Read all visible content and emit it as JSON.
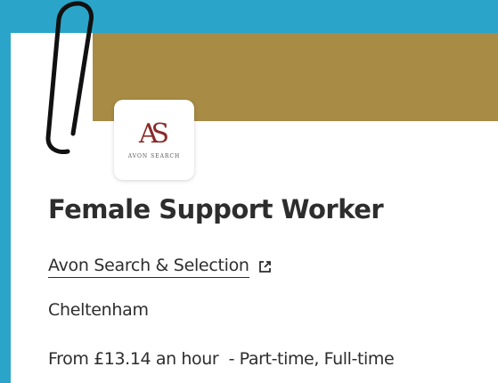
{
  "colors": {
    "page_background": "#2aa5c9",
    "banner": "#a88c45",
    "logo_mark": "#8a2a2a",
    "text": "#2d2d2d"
  },
  "job": {
    "title": "Female Support Worker",
    "company": "Avon Search & Selection",
    "location": "Cheltenham",
    "salary": "From £13.14 an hour",
    "job_type": "- Part-time, Full-time"
  },
  "logo": {
    "mark": "AS",
    "text": "AVON SEARCH"
  },
  "icons": {
    "external_link": "external-link-icon",
    "paperclip": "paperclip-icon"
  }
}
